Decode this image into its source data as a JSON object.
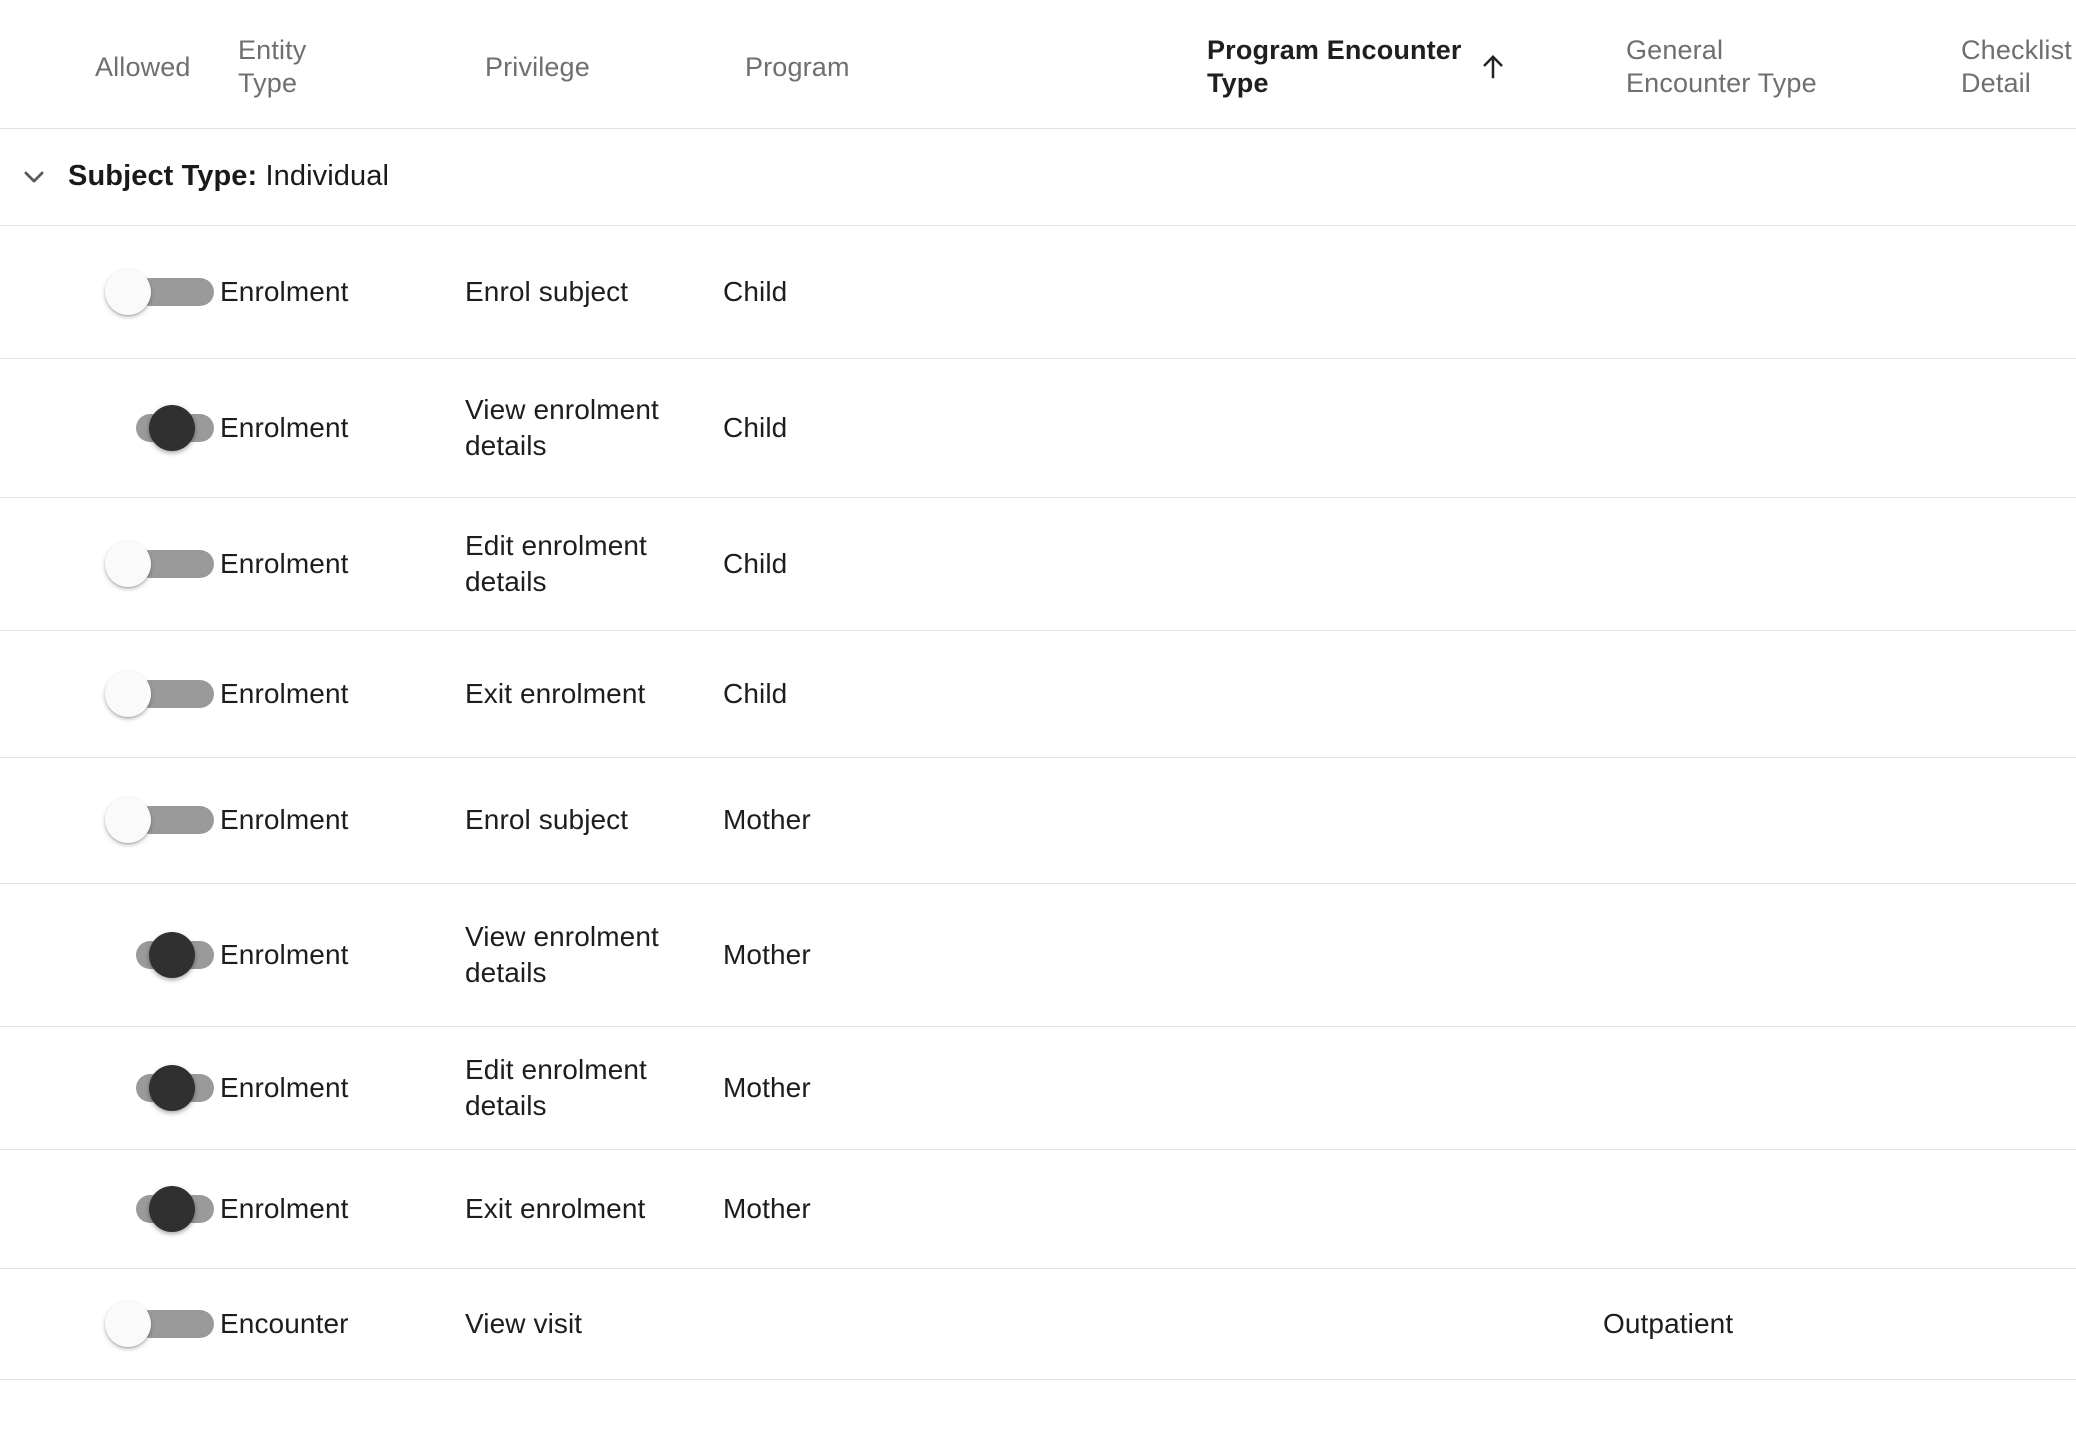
{
  "table": {
    "columns": [
      {
        "key": "allowed",
        "label": "Allowed",
        "sorted": false
      },
      {
        "key": "entity_type",
        "label": "Entity\nType",
        "sorted": false
      },
      {
        "key": "privilege",
        "label": "Privilege",
        "sorted": false
      },
      {
        "key": "program",
        "label": "Program",
        "sorted": false
      },
      {
        "key": "program_encounter_type",
        "label": "Program Encounter\nType",
        "sorted": true,
        "sort_direction": "asc",
        "sort_icon": "arrow-up-icon"
      },
      {
        "key": "general_encounter_type",
        "label": "General\nEncounter Type",
        "sorted": false
      },
      {
        "key": "checklist_detail",
        "label": "Checklist\nDetail",
        "sorted": false
      }
    ],
    "group": {
      "expand_icon": "chevron-down-icon",
      "expanded": true,
      "label_bold": "Subject Type:",
      "label_value": " Individual"
    },
    "rows": [
      {
        "allowed": false,
        "entity_type": "Enrolment",
        "privilege": "Enrol subject",
        "program": "Child",
        "program_encounter_type": "",
        "general_encounter_type": "",
        "checklist_detail": ""
      },
      {
        "allowed": true,
        "entity_type": "Enrolment",
        "privilege": "View enrolment details",
        "program": "Child",
        "program_encounter_type": "",
        "general_encounter_type": "",
        "checklist_detail": ""
      },
      {
        "allowed": false,
        "entity_type": "Enrolment",
        "privilege": "Edit enrolment details",
        "program": "Child",
        "program_encounter_type": "",
        "general_encounter_type": "",
        "checklist_detail": ""
      },
      {
        "allowed": false,
        "entity_type": "Enrolment",
        "privilege": "Exit enrolment",
        "program": "Child",
        "program_encounter_type": "",
        "general_encounter_type": "",
        "checklist_detail": ""
      },
      {
        "allowed": false,
        "entity_type": "Enrolment",
        "privilege": "Enrol subject",
        "program": "Mother",
        "program_encounter_type": "",
        "general_encounter_type": "",
        "checklist_detail": ""
      },
      {
        "allowed": true,
        "entity_type": "Enrolment",
        "privilege": "View enrolment details",
        "program": "Mother",
        "program_encounter_type": "",
        "general_encounter_type": "",
        "checklist_detail": ""
      },
      {
        "allowed": true,
        "entity_type": "Enrolment",
        "privilege": "Edit enrolment details",
        "program": "Mother",
        "program_encounter_type": "",
        "general_encounter_type": "",
        "checklist_detail": ""
      },
      {
        "allowed": true,
        "entity_type": "Enrolment",
        "privilege": "Exit enrolment",
        "program": "Mother",
        "program_encounter_type": "",
        "general_encounter_type": "",
        "checklist_detail": ""
      },
      {
        "allowed": false,
        "entity_type": "Encounter",
        "privilege": "View visit",
        "program": "",
        "program_encounter_type": "",
        "general_encounter_type": "Outpatient",
        "checklist_detail": ""
      }
    ]
  },
  "colors": {
    "header_text": "#6f6f6f",
    "header_text_active": "#1f1f1f",
    "body_text": "#1d1d1d",
    "divider": "#e3e3e3",
    "toggle_track": "#9a9a9a",
    "toggle_knob_off": "#fafafa",
    "toggle_knob_on": "#303030",
    "background": "#ffffff"
  }
}
